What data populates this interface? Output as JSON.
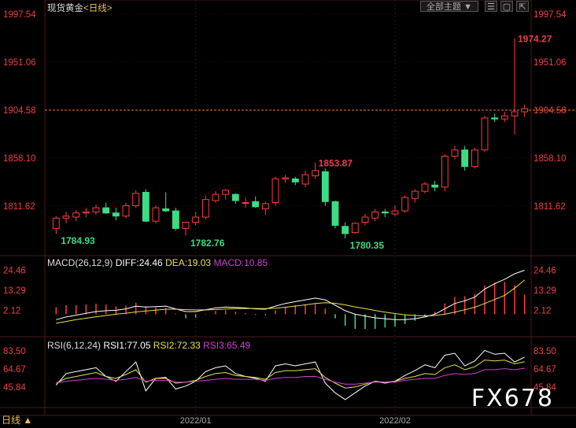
{
  "header": {
    "symbol": "现货黄金",
    "period_label": "<日线>"
  },
  "toolbar": {
    "theme_label": "全部主题",
    "dropdown_icon": "triangle-down-icon",
    "icons": [
      "list-icon",
      "window-icon",
      "export-icon"
    ]
  },
  "footer": {
    "period_button": "日线 ▲"
  },
  "watermark": "FX678",
  "colors": {
    "up": "#ff3b3b",
    "down": "#3ddc84",
    "grid": "#4a1a1a",
    "axis_text": "#e8404a",
    "diff": "#ffffff",
    "dea": "#e8e04a",
    "macd_label": "#d040d0",
    "rsi1": "#ffffff",
    "rsi2": "#e8e04a",
    "rsi3": "#d040d0"
  },
  "chart_data": [
    {
      "type": "candlestick",
      "name": "main",
      "y_ticks": [
        "1997.54",
        "1951.06",
        "1904.58",
        "1858.10",
        "1811.62"
      ],
      "y_tick_values": [
        1997.54,
        1951.06,
        1904.58,
        1858.1,
        1811.62
      ],
      "reference_line": 1904.58,
      "x_ticks": [
        {
          "label": "2022/01",
          "index": 14
        },
        {
          "label": "2022/02",
          "index": 34
        }
      ],
      "annotations": [
        {
          "text": "1784.93",
          "index": 0,
          "value": 1784.93,
          "kind": "low"
        },
        {
          "text": "1782.76",
          "index": 13,
          "value": 1782.76,
          "kind": "low"
        },
        {
          "text": "1853.87",
          "index": 26,
          "value": 1853.87,
          "kind": "high"
        },
        {
          "text": "1780.35",
          "index": 29,
          "value": 1780.35,
          "kind": "low"
        },
        {
          "text": "1974.27",
          "index": 46,
          "value": 1974.27,
          "kind": "high"
        }
      ],
      "ohlc": [
        [
          1790,
          1802,
          1785,
          1800
        ],
        [
          1800,
          1806,
          1795,
          1802
        ],
        [
          1801,
          1808,
          1797,
          1805
        ],
        [
          1805,
          1810,
          1801,
          1806
        ],
        [
          1806,
          1813,
          1803,
          1810
        ],
        [
          1810,
          1815,
          1804,
          1805
        ],
        [
          1805,
          1810,
          1798,
          1802
        ],
        [
          1802,
          1815,
          1800,
          1812
        ],
        [
          1812,
          1827,
          1810,
          1824
        ],
        [
          1825,
          1828,
          1796,
          1797
        ],
        [
          1797,
          1812,
          1795,
          1810
        ],
        [
          1809,
          1825,
          1806,
          1807
        ],
        [
          1807,
          1810,
          1788,
          1790
        ],
        [
          1790,
          1796,
          1783,
          1796
        ],
        [
          1796,
          1806,
          1793,
          1801
        ],
        [
          1801,
          1822,
          1799,
          1818
        ],
        [
          1817,
          1826,
          1815,
          1823
        ],
        [
          1823,
          1828,
          1818,
          1827
        ],
        [
          1823,
          1824,
          1814,
          1817
        ],
        [
          1815,
          1820,
          1810,
          1815
        ],
        [
          1816,
          1821,
          1810,
          1811
        ],
        [
          1809,
          1816,
          1803,
          1814
        ],
        [
          1815,
          1840,
          1812,
          1838
        ],
        [
          1838,
          1842,
          1834,
          1839
        ],
        [
          1838,
          1840,
          1832,
          1835
        ],
        [
          1833,
          1846,
          1830,
          1842
        ],
        [
          1841,
          1853.87,
          1838,
          1846
        ],
        [
          1845,
          1848,
          1812,
          1816
        ],
        [
          1816,
          1817,
          1790,
          1793
        ],
        [
          1792,
          1796,
          1780.35,
          1785
        ],
        [
          1786,
          1796,
          1785,
          1795
        ],
        [
          1796,
          1804,
          1793,
          1801
        ],
        [
          1800,
          1809,
          1797,
          1806
        ],
        [
          1806,
          1809,
          1801,
          1805
        ],
        [
          1804,
          1812,
          1802,
          1807
        ],
        [
          1807,
          1822,
          1805,
          1820
        ],
        [
          1819,
          1828,
          1815,
          1826
        ],
        [
          1826,
          1835,
          1824,
          1833
        ],
        [
          1832,
          1836,
          1826,
          1830
        ],
        [
          1830,
          1862,
          1826,
          1860
        ],
        [
          1860,
          1870,
          1857,
          1866
        ],
        [
          1866,
          1870,
          1846,
          1850
        ],
        [
          1850,
          1868,
          1848,
          1866
        ],
        [
          1866,
          1899,
          1864,
          1897
        ],
        [
          1897,
          1901,
          1893,
          1896
        ],
        [
          1896,
          1903,
          1893,
          1899
        ],
        [
          1899,
          1974.27,
          1881,
          1903
        ],
        [
          1903,
          1910,
          1898,
          1906
        ]
      ]
    },
    {
      "type": "line-bar",
      "name": "MACD",
      "title": "MACD(26,12,9)",
      "readouts": [
        {
          "label": "DIFF",
          "value": "24.46"
        },
        {
          "label": "DEA",
          "value": "19.03"
        },
        {
          "label": "MACD",
          "value": "10.85"
        }
      ],
      "y_ticks": [
        "24.46",
        "13.29",
        "2.12"
      ],
      "y_tick_values": [
        24.46,
        13.29,
        2.12
      ],
      "ylim": [
        -9,
        26
      ],
      "series": [
        {
          "name": "DIFF",
          "values": [
            -3,
            -1.5,
            -0.5,
            0.5,
            1.5,
            2,
            2.2,
            3,
            4.5,
            4,
            4.2,
            4.5,
            3,
            1.5,
            1.5,
            2.5,
            3.5,
            4,
            3.8,
            3.5,
            3,
            2.8,
            4.5,
            6,
            7,
            8,
            9,
            8,
            5,
            2,
            0,
            -1,
            -2,
            -2.5,
            -3,
            -3,
            -2.5,
            -1.5,
            0,
            3,
            6,
            7.5,
            9.5,
            14,
            17,
            19.5,
            22.5,
            24.46
          ]
        },
        {
          "name": "DEA",
          "values": [
            -5,
            -4,
            -3,
            -2.2,
            -1.4,
            -0.7,
            0,
            0.6,
            1.3,
            1.8,
            2.3,
            2.8,
            2.8,
            2.6,
            2.4,
            2.4,
            2.6,
            2.9,
            3.1,
            3.2,
            3.2,
            3.1,
            3.4,
            3.9,
            4.5,
            5.2,
            6,
            6.4,
            6.1,
            5.2,
            4.1,
            3.1,
            2.1,
            1.2,
            0.4,
            -0.3,
            -0.7,
            -0.9,
            -0.7,
            0,
            1.2,
            2.5,
            3.9,
            6,
            8.2,
            10.5,
            14.5,
            19.03
          ]
        },
        {
          "name": "MACD",
          "values": [
            4,
            5,
            5,
            5.4,
            5.8,
            5.4,
            4.4,
            4.8,
            6.4,
            4.4,
            3.8,
            3.4,
            0.4,
            -2.2,
            -1.8,
            0.2,
            1.8,
            2.2,
            1.4,
            0.6,
            -0.4,
            -0.6,
            2.2,
            4.2,
            5,
            5.6,
            6,
            3.2,
            -2.2,
            -6.4,
            -8.2,
            -8.2,
            -8.2,
            -7.4,
            -6.8,
            -5.4,
            -3.6,
            -1.2,
            1.4,
            6,
            9.6,
            10,
            11.2,
            16,
            17.6,
            18,
            16,
            10.85
          ]
        }
      ]
    },
    {
      "type": "line",
      "name": "RSI",
      "title": "RSI(6,12,24)",
      "readouts": [
        {
          "label": "RSI1",
          "value": "77.05"
        },
        {
          "label": "RSI2",
          "value": "72.33"
        },
        {
          "label": "RSI3",
          "value": "65.49"
        }
      ],
      "y_ticks": [
        "83.50",
        "64.67",
        "45.84"
      ],
      "y_tick_values": [
        83.5,
        64.67,
        45.84
      ],
      "ylim": [
        28,
        90
      ],
      "series": [
        {
          "name": "RSI1",
          "values": [
            48,
            60,
            62,
            64,
            66,
            57,
            52,
            62,
            72,
            42,
            55,
            56,
            44,
            47,
            52,
            62,
            66,
            68,
            60,
            57,
            55,
            52,
            68,
            70,
            68,
            70,
            72,
            50,
            40,
            33,
            40,
            47,
            52,
            50,
            52,
            58,
            63,
            69,
            66,
            79,
            81,
            68,
            73,
            84,
            80,
            81,
            72,
            77.05
          ]
        },
        {
          "name": "RSI2",
          "values": [
            50,
            55,
            57,
            59,
            61,
            57,
            55,
            59,
            64,
            51,
            55,
            55,
            50,
            51,
            53,
            57,
            60,
            61,
            58,
            57,
            56,
            54,
            61,
            63,
            63,
            64,
            65,
            56,
            50,
            45,
            46,
            49,
            52,
            51,
            52,
            55,
            57,
            60,
            59,
            66,
            69,
            64,
            67,
            74,
            73,
            74,
            70,
            72.33
          ]
        },
        {
          "name": "RSI3",
          "values": [
            50,
            52,
            53,
            54,
            55,
            54,
            53,
            54,
            56,
            52,
            53,
            53,
            51,
            51,
            52,
            53,
            54,
            55,
            54,
            54,
            54,
            53,
            55,
            56,
            56,
            57,
            57,
            54,
            51,
            49,
            49,
            50,
            51,
            51,
            51,
            53,
            54,
            55,
            55,
            58,
            60,
            59,
            60,
            64,
            64,
            65,
            64,
            65.49
          ]
        }
      ]
    }
  ]
}
